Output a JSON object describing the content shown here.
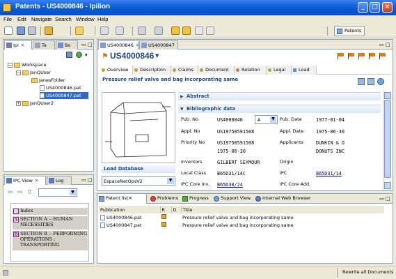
{
  "window": {
    "title": "Patents - US4000846 - Ipilion"
  },
  "menu": [
    "File",
    "Edit",
    "Navigate",
    "Search",
    "Window",
    "Help"
  ],
  "toolbar": {
    "perspective_label": "Patents"
  },
  "left_top": {
    "tabs": [
      {
        "label": "Ipi"
      },
      {
        "label": "Ta"
      },
      {
        "label": "Bo"
      }
    ],
    "tree": {
      "workspace": "Workspace",
      "user1": "JanQUser",
      "folder": "JanesFolder",
      "file1": "US4000846.pat",
      "file2": "US4000847.pat",
      "user2": "JanQUser2"
    }
  },
  "left_bottom": {
    "tabs": [
      {
        "label": "IPC View"
      },
      {
        "label": "Log"
      }
    ],
    "ipc": [
      {
        "code": "",
        "label": "Index"
      },
      {
        "code": "A",
        "label": "SECTION A -- HUMAN NECESSITIES"
      },
      {
        "code": "B",
        "label": "SECTION B -- PERFORMING OPERATIONS ; TRANSPORTING"
      }
    ]
  },
  "editor": {
    "tabs": [
      {
        "label": "US4000846"
      },
      {
        "label": "US4000847"
      }
    ],
    "heading": "US4000846",
    "subtabs": [
      "Overview",
      "Description",
      "Claims",
      "Document",
      "Relation",
      "Legal",
      "Load"
    ],
    "title": "Pressure relief valve and bag incorporating same",
    "abstract_label": "Abstract",
    "biblio_label": "Bibliographic data",
    "load_db": {
      "label": "Load Database",
      "value": "EspaceNetOpsV2"
    },
    "fields": {
      "pub_no_label": "Pub. No",
      "pub_no": "US4000846",
      "pub_kind": "A",
      "pub_date_label": "Pub. Date",
      "pub_date": "1977-01-04",
      "appl_no_label": "Appl. No",
      "appl_no": "US19750591508",
      "appl_date_label": "Appl. Date",
      "appl_date": "1975-06-30",
      "priority_label": "Priority No",
      "priority_no": "US19750591508",
      "priority_date": "1975-06-30",
      "applicants_label": "Applicants",
      "applicants1": "DUNKIN & O",
      "applicants2": "DONUTS INC",
      "inventors_label": "Inventors",
      "inventors": "GILBERT SEYMOUR",
      "origin_label": "Origin",
      "local_class_label": "Local Class",
      "local_class": "B65D31/14C",
      "ipc_label": "IPC",
      "ipc": "B65D31/14",
      "ipc_core_inv_label": "IPC Core Inv.",
      "ipc_core_inv": "B65D30/24",
      "ipc_core_add_label": "IPC Core Add."
    }
  },
  "bottom": {
    "tabs": [
      "Patent list",
      "Problems",
      "Progress",
      "Support View",
      "Internal Web Browser"
    ],
    "columns": [
      "Publication",
      "R",
      "D",
      "Title"
    ],
    "rows": [
      {
        "pub": "US4000846.pat",
        "title": "Pressure relief valve and bag incorporating same"
      },
      {
        "pub": "US4000847.pat",
        "title": "Pressure relief valve and bag incorporating same"
      }
    ]
  },
  "status": {
    "text": "Rewrite all Documents"
  },
  "colors": {
    "titlebar": "#0a5fd8",
    "selection": "#316ac5",
    "link": "#00007f",
    "section": "#1f4a84"
  }
}
